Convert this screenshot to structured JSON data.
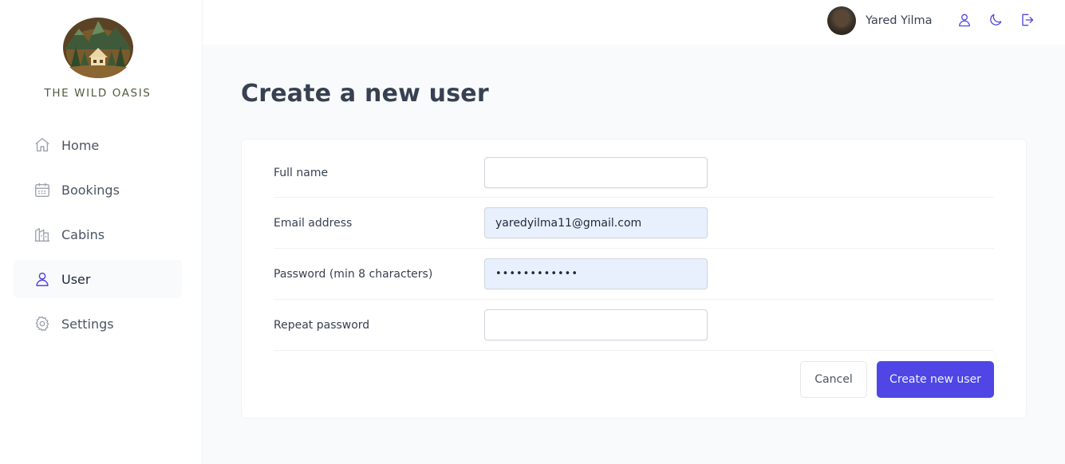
{
  "brand": {
    "name": "THE WILD OASIS"
  },
  "sidebar": {
    "items": [
      {
        "label": "Home",
        "icon": "home-icon",
        "active": false
      },
      {
        "label": "Bookings",
        "icon": "calendar-icon",
        "active": false
      },
      {
        "label": "Cabins",
        "icon": "cabins-icon",
        "active": false
      },
      {
        "label": "User",
        "icon": "user-icon",
        "active": true
      },
      {
        "label": "Settings",
        "icon": "gear-icon",
        "active": false
      }
    ]
  },
  "header": {
    "user_name": "Yared Yilma",
    "icons": [
      "account-icon",
      "dark-mode-moon-icon",
      "logout-icon"
    ]
  },
  "page": {
    "title": "Create a new user"
  },
  "form": {
    "full_name": {
      "label": "Full name",
      "value": ""
    },
    "email": {
      "label": "Email address",
      "value": "yaredyilma11@gmail.com"
    },
    "password": {
      "label": "Password (min 8 characters)",
      "value": "••••••••••••"
    },
    "repeat_password": {
      "label": "Repeat password",
      "value": ""
    },
    "cancel_label": "Cancel",
    "submit_label": "Create new user"
  },
  "colors": {
    "accent": "#4f46e5",
    "autofill_bg": "#e8f0fe",
    "page_bg": "#f9fafb",
    "brand_green": "#4e5b3c"
  }
}
